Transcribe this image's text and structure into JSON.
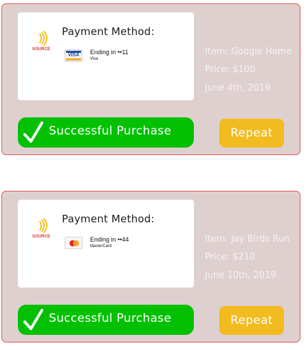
{
  "purchases": [
    {
      "merchant_logo_text": "SOURCE",
      "payment_method_title": "Payment Method:",
      "card_type_icon": "visa-card-icon",
      "ending_text": "Ending in ••11",
      "card_brand": "Visa",
      "item": "Item: Google Home",
      "price": "Price: $100",
      "date": "June 4th, 2019",
      "status_label": "Successful Purchase",
      "repeat_label": "Repeat"
    },
    {
      "merchant_logo_text": "SOURCE",
      "payment_method_title": "Payment Method:",
      "card_type_icon": "mastercard-icon",
      "ending_text": "Ending in ••44",
      "card_brand": "MasterCard",
      "item": "Item: Jay Birds Run",
      "price": "Price: $210",
      "date": "June 10th, 2019",
      "status_label": "Successful Purchase",
      "repeat_label": "Repeat"
    }
  ],
  "colors": {
    "card_background": "#dfd0d0",
    "card_border": "#e2504f",
    "success_green": "#03c003",
    "repeat_yellow": "#f2bb1f",
    "logo_red": "#d9322a",
    "logo_yellow": "#f5b800"
  }
}
